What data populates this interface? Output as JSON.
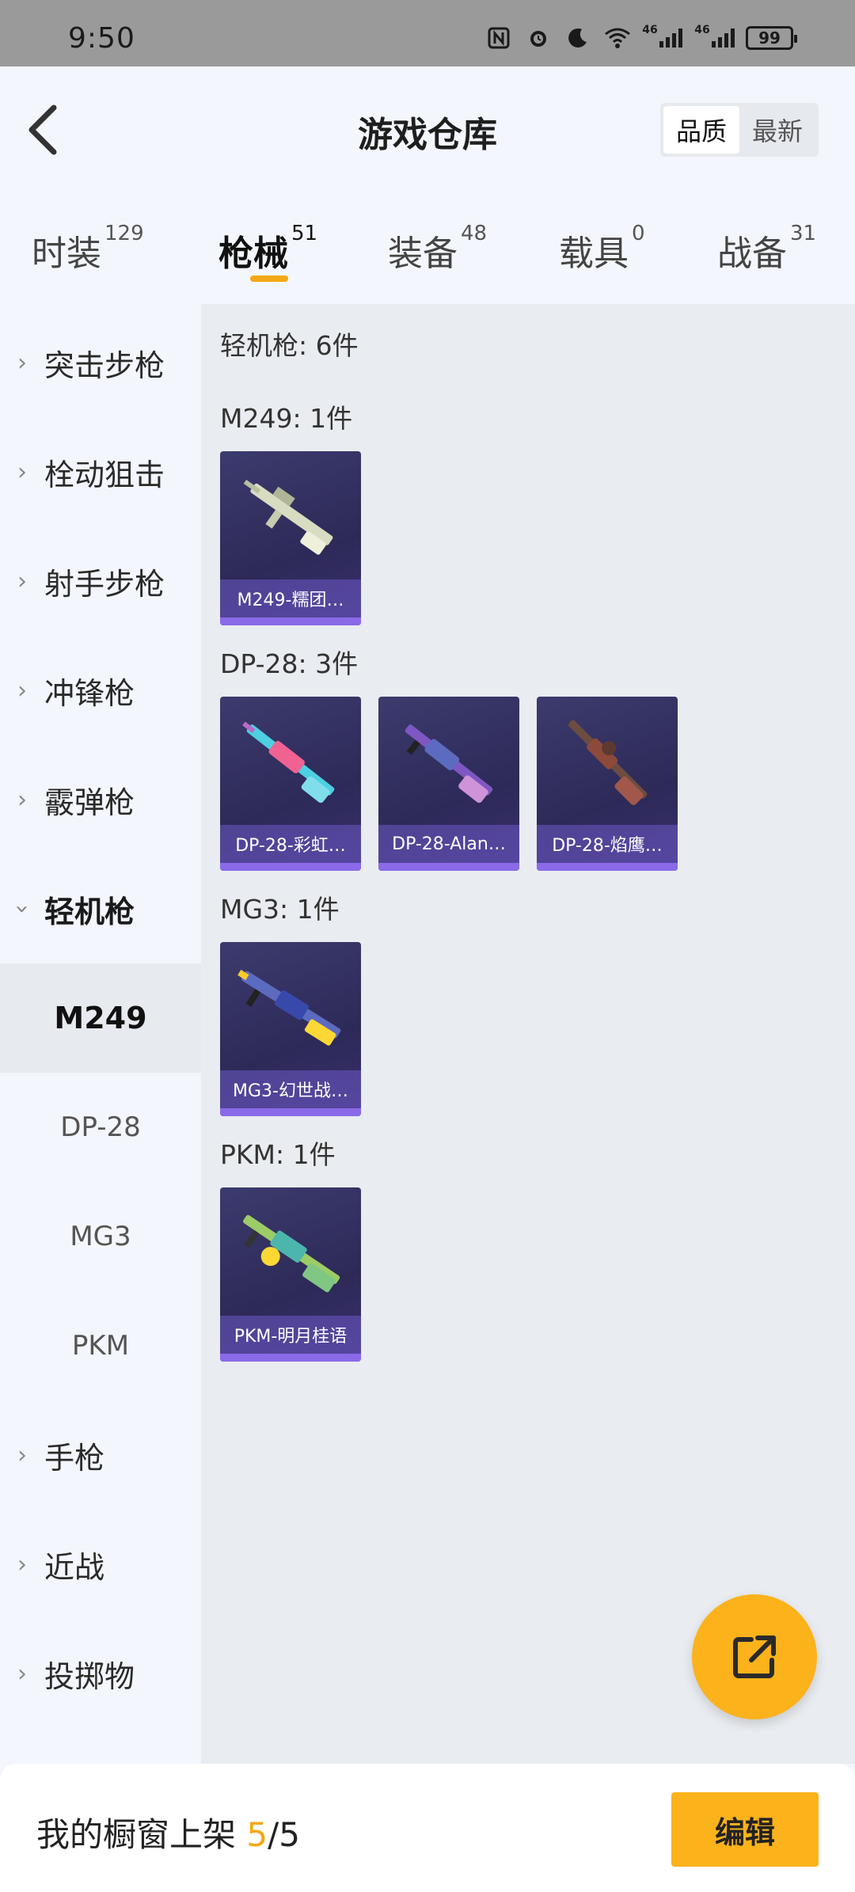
{
  "status_bar": {
    "time": "9:50",
    "icons": [
      "nfc-icon",
      "alarm-icon",
      "moon-icon",
      "wifi-icon",
      "signal-4g-icon",
      "signal-4g-icon"
    ],
    "network_label_1": "46",
    "network_label_2": "46",
    "battery": "99"
  },
  "header": {
    "title": "游戏仓库",
    "sort": {
      "quality": "品质",
      "newest": "最新",
      "selected": "quality"
    }
  },
  "tabs": [
    {
      "label": "时装",
      "count": "129"
    },
    {
      "label": "枪械",
      "count": "51",
      "active": true
    },
    {
      "label": "装备",
      "count": "48"
    },
    {
      "label": "载具",
      "count": "0"
    },
    {
      "label": "战备",
      "count": "31"
    }
  ],
  "sidebar": {
    "categories": [
      {
        "label": "突击步枪"
      },
      {
        "label": "栓动狙击"
      },
      {
        "label": "射手步枪"
      },
      {
        "label": "冲锋枪"
      },
      {
        "label": "霰弹枪"
      },
      {
        "label": "轻机枪",
        "expanded": true
      },
      {
        "label": "手枪"
      },
      {
        "label": "近战"
      },
      {
        "label": "投掷物"
      }
    ],
    "subitems": [
      {
        "label": "M249",
        "active": true
      },
      {
        "label": "DP-28"
      },
      {
        "label": "MG3"
      },
      {
        "label": "PKM"
      }
    ]
  },
  "content": {
    "total": "轻机枪: 6件",
    "groups": [
      {
        "title": "M249: 1件",
        "items": [
          {
            "name": "M249-糯团…"
          }
        ]
      },
      {
        "title": "DP-28: 3件",
        "items": [
          {
            "name": "DP-28-彩虹…"
          },
          {
            "name": "DP-28-Alan…"
          },
          {
            "name": "DP-28-焰鹰…"
          }
        ]
      },
      {
        "title": "MG3: 1件",
        "items": [
          {
            "name": "MG3-幻世战…"
          }
        ]
      },
      {
        "title": "PKM: 1件",
        "items": [
          {
            "name": "PKM-明月桂语"
          }
        ]
      }
    ]
  },
  "fab": {
    "icon": "share-external-icon"
  },
  "footer": {
    "showcase_label": "我的橱窗上架 ",
    "count_current": "5",
    "count_sep": "/",
    "count_total": "5",
    "edit_label": "编辑"
  },
  "colors": {
    "accent": "#f5a816",
    "button": "#fbb21b",
    "card_bg": "#2d2a58"
  }
}
